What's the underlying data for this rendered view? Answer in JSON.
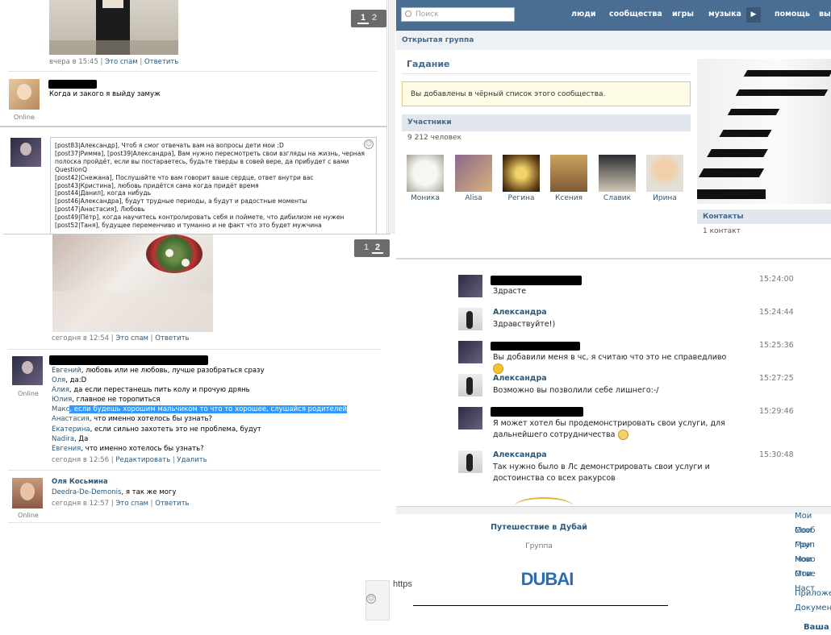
{
  "left_top": {
    "post_time": "вчера в 15:45",
    "spam_link": "Это спам",
    "reply_link": "Ответить",
    "pager": {
      "p1": "1",
      "p2": "2"
    },
    "comment1": {
      "text": "Когда и закого я выйду замуж",
      "status": "Online"
    },
    "textarea_lines": [
      "[post83|Александр], Чтоб я смог отвечать вам на вопросы дети мои :D",
      "[post37|Римма], [post39|Александра], Вам нужно пересмотреть свои взгляды на жизнь, черная",
      "полоска пройдёт, если вы постараетесь, будьте тверды в совей вере, да прибудет с вами",
      "QuestionQ",
      "[post42|Снежана], Послушайте что вам говорит ваше сердце, ответ внутри вас",
      "[post43|Кристина], любовь придётся сама когда придёт время",
      "[post44|Данил], когда нибудь",
      "[post46|Александра], будут трудные периоды, а будут и радостные моменты",
      "[post47|Анастасия], Любовь",
      "[post49|Пётр], когда научитесь контролировать себя и поймете, что дибилизм не нужен",
      "[post52|Таня], будущее переменчиво и туманно и не факт что это будет мужчина"
    ]
  },
  "left_bottom": {
    "pager": {
      "p1": "1",
      "p2": "2"
    },
    "post_time": "сегодня в 12:54",
    "spam_link": "Это спам",
    "reply_link": "Ответить",
    "comment_status": "Online",
    "lines": [
      {
        "name": "Евгений",
        "text": ", любовь или не любовь, лучше разобраться сразу"
      },
      {
        "name": "Оля",
        "text": ", да:D"
      },
      {
        "name": "Алия",
        "text": ", да если перестанешь пить колу и прочую дрянь"
      },
      {
        "name": "Юлия",
        "text": ", главное не торопиться"
      },
      {
        "name": "Макс",
        "text": ", если будешь хорошим мальчиком то что то хорошее, слушайся родителей"
      },
      {
        "name": "Анастасия",
        "text": ", что именно хотелось бы узнать?"
      },
      {
        "name": "Екатерина",
        "text": ", если сильно захотеть это не проблема, будут"
      },
      {
        "name": "Nadira",
        "text": ", Да"
      },
      {
        "name": "Евгения",
        "text": ", что именно хотелось бы узнать?"
      }
    ],
    "meta2_time": "сегодня в 12:56",
    "edit_link": "Редактировать",
    "delete_link": "Удалить",
    "comment2": {
      "author": "Оля Косьмина",
      "mention": "Deedra-De-Demonis",
      "text": ", я так же могу",
      "time": "сегодня в 12:57",
      "spam_link": "Это спам",
      "reply_link": "Ответить",
      "status": "Online"
    }
  },
  "group": {
    "search_placeholder": "Поиск",
    "nav": [
      "люди",
      "сообщества",
      "игры",
      "музыка",
      "помощь",
      "вы"
    ],
    "type": "Открытая группа",
    "name": "Гадание",
    "blacklist_notice": "Вы добавлены в чёрный список этого сообщества.",
    "members_title": "Участники",
    "members_count": "9 212 человек",
    "members": [
      "Моника",
      "Alisa",
      "Регина",
      "Ксения",
      "Славик",
      "Ирина"
    ],
    "contacts_title": "Контакты",
    "contacts_count": "1 контакт"
  },
  "chat": [
    {
      "name": "",
      "time": "15:24:00",
      "text": "Здрасте",
      "redacted": true
    },
    {
      "name": "Александра",
      "time": "15:24:44",
      "text": "Здравствуйте!)",
      "redacted": false
    },
    {
      "name": "",
      "time": "15:25:36",
      "text": "Вы добавили меня в чс, я считаю что это не справедливо",
      "redacted": true
    },
    {
      "name": "Александра",
      "time": "15:27:25",
      "text": "Возможно вы позволили себе лишнего:-/",
      "redacted": false
    },
    {
      "name": "",
      "time": "15:29:46",
      "text": "Я может хотел бы продемонстрировать свои услуги, для дальнейшего сотрудничества",
      "redacted": true
    },
    {
      "name": "Александра",
      "time": "15:30:48",
      "text": "Так нужно было в Лс демонстрировать свои услуги и достоинства со всех ракурсов",
      "redacted": false
    }
  ],
  "ad": {
    "title": "Путешествие в Дубай",
    "subtitle": "Группа",
    "logo_text": "DUBAI"
  },
  "menu": [
    "Мои Сооб",
    "Мои Груп",
    "Мои Ново",
    "Мои Отве",
    "Мои Наст",
    "Приложе",
    "Документ",
    "Ваша с"
  ],
  "url_fragment": "https"
}
